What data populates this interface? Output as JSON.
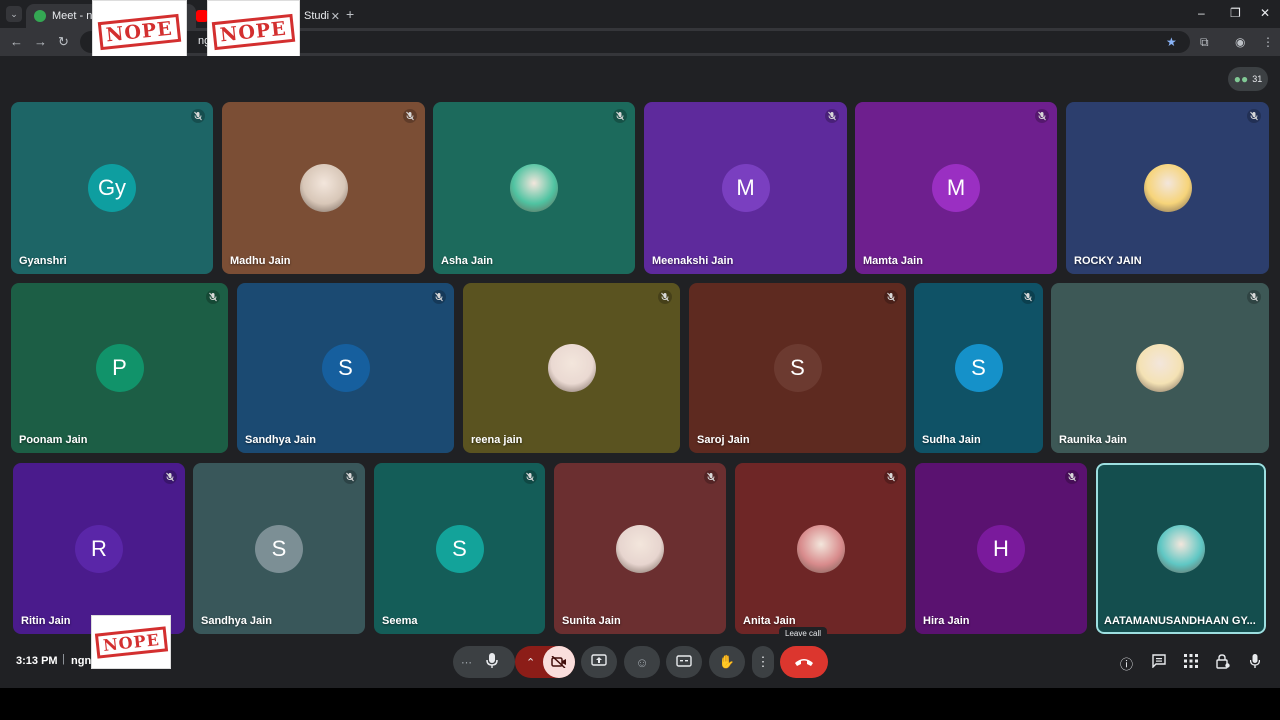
{
  "browser": {
    "tabs": [
      {
        "title": "Meet - ngn-d"
      },
      {
        "title": "Studi"
      }
    ],
    "url_fragment": "ngn-dz"
  },
  "stamp_text": "NOPE",
  "participants_count": "31",
  "tiles": [
    {
      "name": "Gyanshri",
      "avatar": "Gy",
      "bg": "#1d6566",
      "avatar_bg": "#0e9ea0",
      "muted_icon": "mic-off-icon"
    },
    {
      "name": "Madhu Jain",
      "avatar": "",
      "bg": "#7b4e35",
      "avatar_bg": "#d8c7b8",
      "muted_icon": "mic-off-icon"
    },
    {
      "name": "Asha Jain",
      "avatar": "",
      "bg": "#1c6a5c",
      "avatar_bg": "#4fc3a1",
      "muted_icon": "mic-off-icon"
    },
    {
      "name": "Meenakshi Jain",
      "avatar": "M",
      "bg": "#5e2a9c",
      "avatar_bg": "#7a3fc0",
      "muted_icon": "mic-off-icon"
    },
    {
      "name": "Mamta Jain",
      "avatar": "M",
      "bg": "#6e1f8e",
      "avatar_bg": "#9a2fc2",
      "muted_icon": "mic-off-icon"
    },
    {
      "name": "ROCKY JAIN",
      "avatar": "",
      "bg": "#2c3e6d",
      "avatar_bg": "#f6d47a",
      "muted_icon": "mic-off-icon"
    },
    {
      "name": "Poonam Jain",
      "avatar": "P",
      "bg": "#1c5e45",
      "avatar_bg": "#11936a",
      "muted_icon": "mic-off-icon"
    },
    {
      "name": "Sandhya Jain",
      "avatar": "S",
      "bg": "#1b4a72",
      "avatar_bg": "#165f9e",
      "muted_icon": "mic-off-icon"
    },
    {
      "name": "reena jain",
      "avatar": "",
      "bg": "#5a5320",
      "avatar_bg": "#ead9d2",
      "muted_icon": "mic-off-icon"
    },
    {
      "name": "Saroj Jain",
      "avatar": "S",
      "bg": "#5e2a20",
      "avatar_bg": "#6c3a30",
      "muted_icon": "mic-off-icon"
    },
    {
      "name": "Sudha Jain",
      "avatar": "S",
      "bg": "#0f5266",
      "avatar_bg": "#1591c9",
      "muted_icon": "mic-off-icon"
    },
    {
      "name": "Raunika Jain",
      "avatar": "",
      "bg": "#3d5856",
      "avatar_bg": "#f4e2b4",
      "muted_icon": "mic-off-icon"
    },
    {
      "name": "Ritin Jain",
      "avatar": "R",
      "bg": "#4a1b8c",
      "avatar_bg": "#5a26a8",
      "muted_icon": "mic-off-icon"
    },
    {
      "name": "Sandhya Jain",
      "avatar": "S",
      "bg": "#39575a",
      "avatar_bg": "#7c8f95",
      "muted_icon": "mic-off-icon"
    },
    {
      "name": "Seema",
      "avatar": "S",
      "bg": "#145d58",
      "avatar_bg": "#13a39a",
      "muted_icon": "mic-off-icon"
    },
    {
      "name": "Sunita Jain",
      "avatar": "",
      "bg": "#6b2f30",
      "avatar_bg": "#e7d5cf",
      "muted_icon": "mic-off-icon"
    },
    {
      "name": "Anita Jain",
      "avatar": "",
      "bg": "#6e2626",
      "avatar_bg": "#d88b8c",
      "muted_icon": "mic-off-icon"
    },
    {
      "name": "Hira Jain",
      "avatar": "H",
      "bg": "#5a1270",
      "avatar_bg": "#7a1a9c",
      "muted_icon": "mic-off-icon"
    },
    {
      "name": "AATAMANUSANDHAAN GY...",
      "avatar": "",
      "bg": "#144e4e",
      "avatar_bg": "#5fc7c4",
      "muted_icon": "",
      "active": true
    }
  ],
  "meeting_bar": {
    "time": "3:13 PM",
    "separator": "|",
    "code": "ngn",
    "tooltip": "Leave call"
  }
}
